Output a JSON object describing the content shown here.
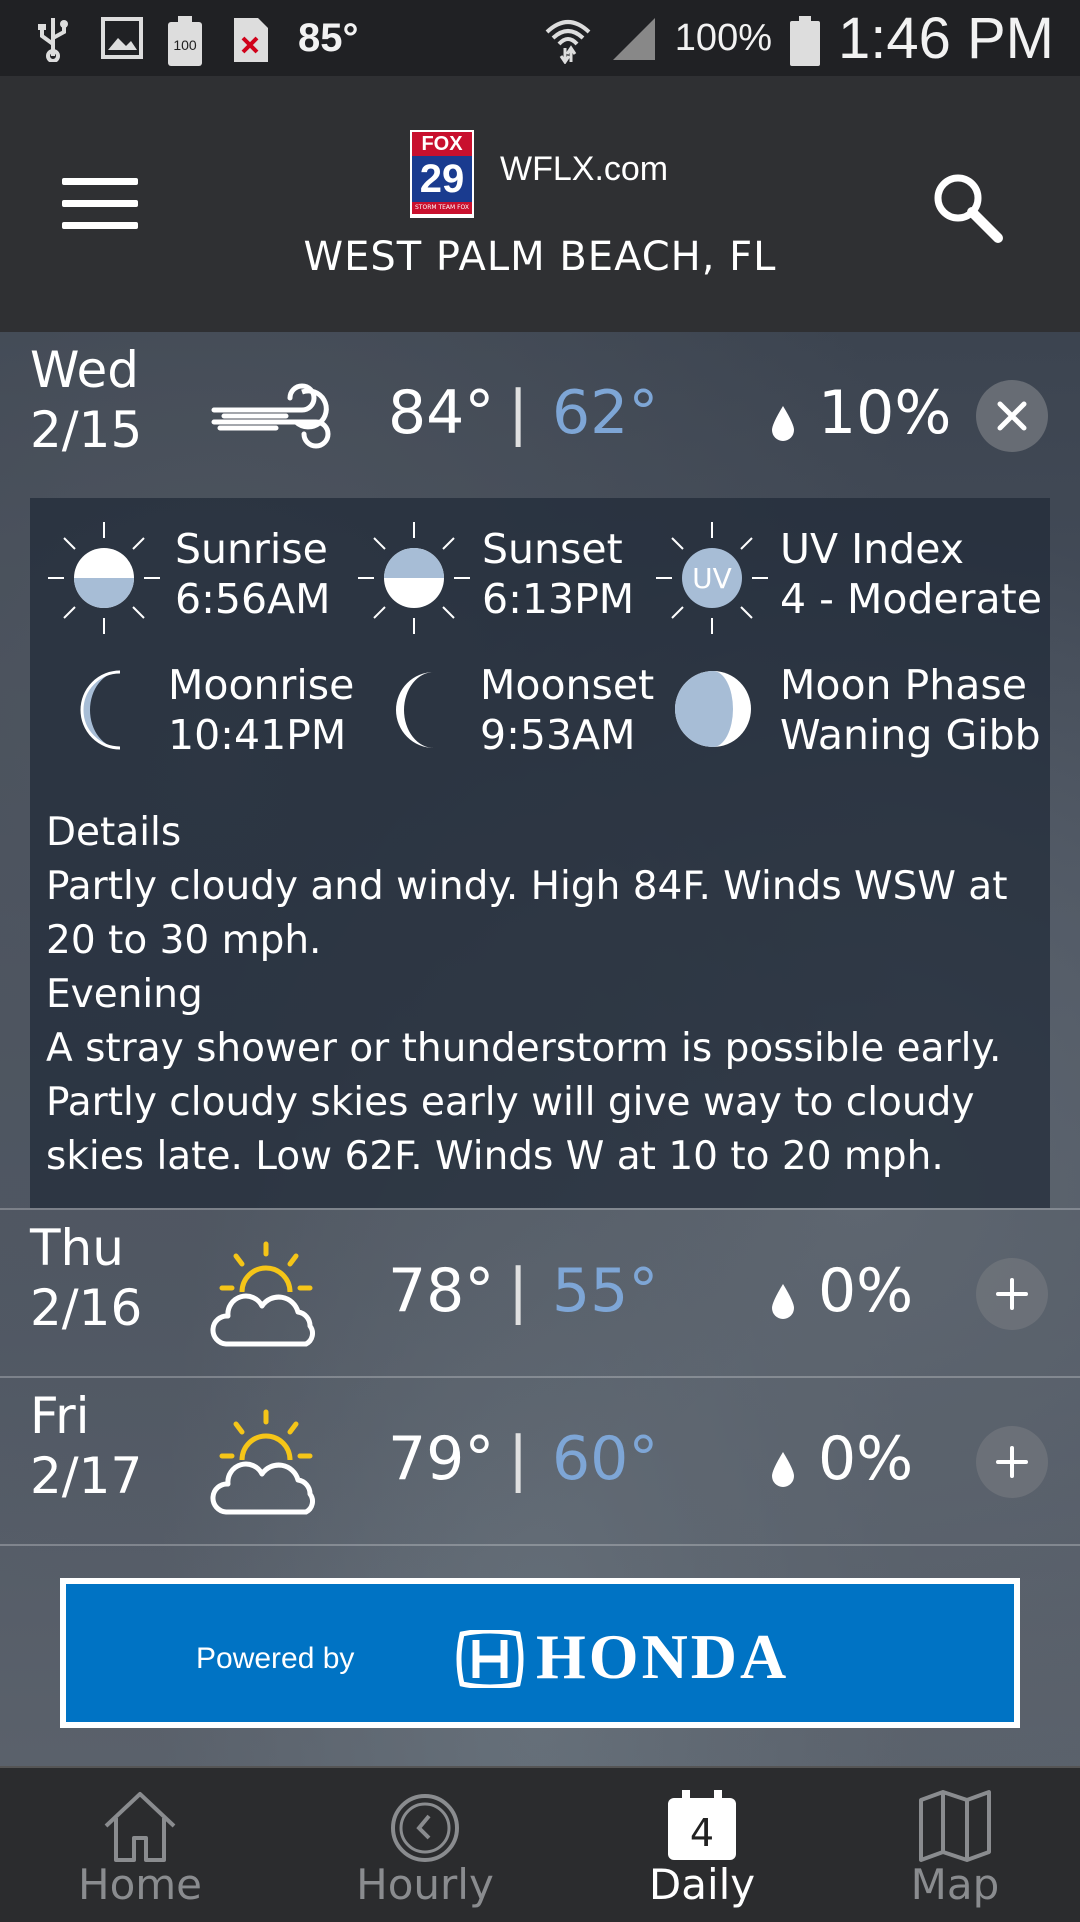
{
  "status_bar": {
    "temperature": "85°",
    "battery_badge": "100",
    "battery_percent": "100%",
    "time": "1:46 PM"
  },
  "header": {
    "logo_top": "FOX",
    "logo_number": "29",
    "logo_bottom": "STORM TEAM FOX",
    "site": "WFLX.com",
    "location": "WEST PALM BEACH, FL"
  },
  "days": [
    {
      "name": "Wed",
      "date": "2/15",
      "icon": "wind-icon",
      "high": "84°",
      "low": "62°",
      "separator": "|",
      "precip": "10%",
      "expanded": true
    },
    {
      "name": "Thu",
      "date": "2/16",
      "icon": "partly-sunny-icon",
      "high": "78°",
      "low": "55°",
      "separator": "|",
      "precip": "0%",
      "expanded": false
    },
    {
      "name": "Fri",
      "date": "2/17",
      "icon": "partly-sunny-icon",
      "high": "79°",
      "low": "60°",
      "separator": "|",
      "precip": "0%",
      "expanded": false
    }
  ],
  "details": {
    "sunrise_label": "Sunrise",
    "sunrise": "6:56AM",
    "sunset_label": "Sunset",
    "sunset": "6:13PM",
    "uv_label": "UV Index",
    "uv": "4 - Moderate",
    "uv_badge": "UV",
    "moonrise_label": "Moonrise",
    "moonrise": "10:41PM",
    "moonset_label": "Moonset",
    "moonset": "9:53AM",
    "moonphase_label": "Moon Phase",
    "moonphase": "Waning Gibbous",
    "details_heading": "Details",
    "details_text": "Partly cloudy and windy. High 84F. Winds WSW at 20 to 30 mph.",
    "evening_heading": "Evening",
    "evening_text": "A stray shower or thunderstorm is possible early. Partly cloudy skies early will give way to cloudy skies late. Low 62F. Winds W at 10 to 20 mph."
  },
  "ad": {
    "powered_by": "Powered by",
    "brand": "HONDA"
  },
  "nav": {
    "home": "Home",
    "hourly": "Hourly",
    "daily": "Daily",
    "daily_badge": "4",
    "map": "Map",
    "active": "daily"
  },
  "colors": {
    "low_temp": "#7ea6d6",
    "honda_blue": "#0073c4"
  }
}
